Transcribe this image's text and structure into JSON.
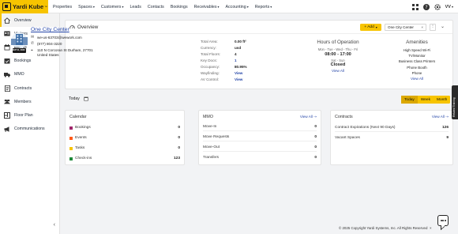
{
  "brand": {
    "logo_text": "Yardi Kube",
    "tm": "™"
  },
  "nav": [
    {
      "label": "Properties",
      "dropdown": false
    },
    {
      "label": "Spaces",
      "dropdown": true
    },
    {
      "label": "Customers",
      "dropdown": true
    },
    {
      "label": "Leads",
      "dropdown": false
    },
    {
      "label": "Contacts",
      "dropdown": false
    },
    {
      "label": "Bookings",
      "dropdown": false
    },
    {
      "label": "Receivables",
      "dropdown": true
    },
    {
      "label": "Accounting",
      "dropdown": true
    },
    {
      "label": "Reports",
      "dropdown": true
    }
  ],
  "user": {
    "initials": "VV"
  },
  "sidebar": {
    "items": [
      {
        "label": "Overview",
        "icon": "home-icon"
      },
      {
        "label": "Visitors",
        "icon": "id-card-icon"
      },
      {
        "label": "Events",
        "icon": "calendar-icon"
      },
      {
        "label": "Bookings",
        "icon": "calendar-check-icon"
      },
      {
        "label": "MMO",
        "icon": "truck-icon"
      },
      {
        "label": "Contracts",
        "icon": "document-icon"
      },
      {
        "label": "Members",
        "icon": "people-icon"
      },
      {
        "label": "Floor Plan",
        "icon": "floor-plan-icon"
      },
      {
        "label": "Communications",
        "icon": "megaphone-icon"
      }
    ],
    "collapse_glyph": "‹"
  },
  "overview": {
    "title": "Overview",
    "add_label": "+ Add",
    "location_value": "One City Center",
    "location_clear": "×",
    "site": {
      "name": "One City Center",
      "email": "we-us-63703@wework.com",
      "phone": "(877) 804-3220",
      "address_line1": "110 N Corcoran St Durham, 27701",
      "address_line2": "United States",
      "badge_top": "OPEN",
      "badge_date": "SEP 01, 2020"
    },
    "stats": [
      {
        "label": "Total Area:",
        "value": "0.00 ft²",
        "link": false
      },
      {
        "label": "Currency:",
        "value": "usd",
        "link": false
      },
      {
        "label": "Total Floors:",
        "value": "4",
        "link": false
      },
      {
        "label": "Key Docs:",
        "value": "1",
        "link": true
      },
      {
        "label": "Occupancy:",
        "value": "80.95%",
        "link": false
      },
      {
        "label": "Wayfinding:",
        "value": "View",
        "link": true
      },
      {
        "label": "AV Control:",
        "value": "View",
        "link": true
      }
    ],
    "hours": {
      "title": "Hours of Operation",
      "weekdays": "Mon - Tue - Wed - Thu - Fri",
      "weekday_time": "08:00 - 17:00",
      "weekend": "Sat - Sun",
      "weekend_status": "Closed",
      "view_all": "View All"
    },
    "amenities": {
      "title": "Amenities",
      "items": [
        "High Speed Wi-Fi",
        "TV/Monitor",
        "Business Class Printers",
        "Phone Booth",
        "Phone"
      ],
      "view_all": "View All"
    }
  },
  "today_bar": {
    "label": "Today",
    "segments": [
      "Today",
      "Week",
      "Month"
    ],
    "selected": "Today"
  },
  "calendar_widget": {
    "title": "Calendar",
    "rows": [
      {
        "label": "Bookings",
        "value": "0",
        "color": "#a0276b"
      },
      {
        "label": "Events",
        "value": "0",
        "color": "#ff5b1a"
      },
      {
        "label": "Tasks",
        "value": "0",
        "color": "#f7c400"
      },
      {
        "label": "Check-ins",
        "value": "123",
        "color": "#1f8a3a"
      }
    ]
  },
  "mmo_widget": {
    "title": "MMO",
    "view_all": "View All ⇢",
    "rows": [
      {
        "label": "Move-In",
        "value": "0"
      },
      {
        "label": "Move Requests",
        "value": "0"
      },
      {
        "label": "Move-Out",
        "value": "0"
      },
      {
        "label": "Transfers",
        "value": "0"
      }
    ]
  },
  "contracts_widget": {
    "title": "Contracts",
    "view_all": "View All ⇢",
    "rows": [
      {
        "label": "Contract Expirations (Next 90 Days)",
        "value": "126"
      },
      {
        "label": "Vacant Spaces",
        "value": "9"
      }
    ]
  },
  "side_tab": {
    "label": "Related Training"
  },
  "footer": {
    "copyright": "© 2025 Copyright Yardi Systems, Inc. All Rights Reserved",
    "close": "×"
  }
}
